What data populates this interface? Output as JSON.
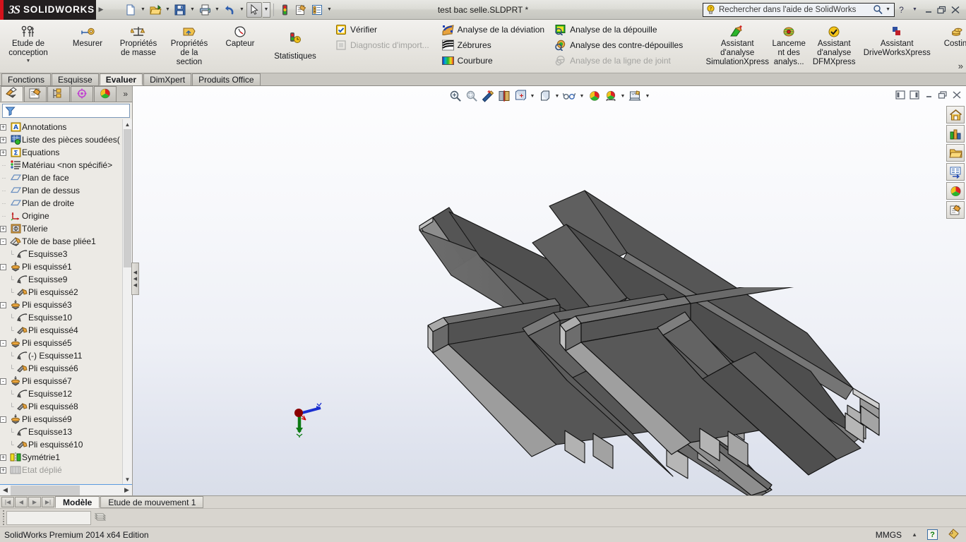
{
  "titlebar": {
    "brand_bs": "3S",
    "brand_name": "SOLIDWORKS",
    "document_title": "test bac selle.SLDPRT *",
    "quick_access": [
      {
        "name": "new-document",
        "icon": "new-doc-icon",
        "dropdown": true
      },
      {
        "name": "open-document",
        "icon": "open-folder-icon",
        "dropdown": true
      },
      {
        "name": "save-document",
        "icon": "save-disk-icon",
        "dropdown": true
      },
      {
        "name": "print-document",
        "icon": "printer-icon",
        "dropdown": true
      },
      {
        "name": "undo",
        "icon": "undo-arrow-icon",
        "dropdown": true
      },
      {
        "name": "select",
        "icon": "cursor-arrow-icon",
        "dropdown": true
      },
      {
        "name": "rebuild",
        "icon": "traffic-light-icon",
        "dropdown": false
      },
      {
        "name": "options",
        "icon": "options-gear-icon",
        "dropdown": false
      },
      {
        "name": "properties",
        "icon": "list-properties-icon",
        "dropdown": true
      }
    ],
    "search_placeholder": "Rechercher dans l'aide de SolidWorks",
    "window_buttons": [
      "help-icon",
      "help-dropdown",
      "minimize-icon",
      "restore-icon",
      "close-icon"
    ]
  },
  "ribbon": {
    "groups": [
      {
        "name": "design-study",
        "type": "big",
        "items": [
          {
            "label": "Etude de\nconception",
            "icon": "design-study-icon",
            "dropdown": true
          }
        ]
      },
      {
        "name": "evaluate-tools",
        "type": "big",
        "items": [
          {
            "label": "Mesurer",
            "icon": "measure-tape-icon",
            "dropdown": false
          },
          {
            "label": "Propriétés\nde masse",
            "icon": "mass-properties-icon",
            "dropdown": false
          },
          {
            "label": "Propriétés\nde la\nsection",
            "icon": "section-properties-icon",
            "dropdown": false
          },
          {
            "label": "Capteur",
            "icon": "sensor-gauge-icon",
            "dropdown": false
          },
          {
            "label": "Statistiques",
            "icon": "statistics-icon",
            "dropdown": false
          }
        ]
      },
      {
        "name": "check-group",
        "type": "small",
        "items": [
          {
            "label": "Vérifier",
            "icon": "check-yellow-icon",
            "disabled": false
          },
          {
            "label": "Diagnostic d'import...",
            "icon": "import-diagnostics-icon",
            "disabled": true
          }
        ]
      },
      {
        "name": "deviation-group",
        "type": "small",
        "items": [
          {
            "label": "Analyse de la déviation",
            "icon": "deviation-analysis-icon",
            "disabled": false
          },
          {
            "label": "Zébrures",
            "icon": "zebra-stripes-icon",
            "disabled": false
          },
          {
            "label": "Courbure",
            "icon": "curvature-rainbow-icon",
            "disabled": false
          }
        ]
      },
      {
        "name": "draft-group",
        "type": "small",
        "items": [
          {
            "label": "Analyse de la dépouille",
            "icon": "draft-analysis-icon",
            "disabled": false
          },
          {
            "label": "Analyse des contre-dépouilles",
            "icon": "undercut-analysis-icon",
            "disabled": false
          },
          {
            "label": "Analyse de la ligne de joint",
            "icon": "parting-line-analysis-icon",
            "disabled": true
          }
        ]
      },
      {
        "name": "xpress-group",
        "type": "big",
        "items": [
          {
            "label": "Assistant\nd'analyse\nSimulationXpress",
            "icon": "simulationxpress-icon",
            "dropdown": false
          },
          {
            "label": "Lanceme\nnt des\nanalys...",
            "icon": "run-analysis-icon",
            "dropdown": false
          },
          {
            "label": "Assistant\nd'analyse\nDFMXpress",
            "icon": "dfmxpress-check-icon",
            "dropdown": false
          },
          {
            "label": "Assistant\nDriveWorksXpress",
            "icon": "driveworksxpress-icon",
            "dropdown": false
          },
          {
            "label": "Costing",
            "icon": "costing-coins-icon",
            "dropdown": false
          }
        ]
      }
    ],
    "overflow_label": "»"
  },
  "command_tabs": [
    {
      "label": "Fonctions",
      "active": false
    },
    {
      "label": "Esquisse",
      "active": false
    },
    {
      "label": "Evaluer",
      "active": true
    },
    {
      "label": "DimXpert",
      "active": false
    },
    {
      "label": "Produits Office",
      "active": false
    }
  ],
  "feature_manager": {
    "tabs": [
      {
        "name": "feature-tree-tab",
        "icon": "feature-tree-icon",
        "active": true
      },
      {
        "name": "property-manager-tab",
        "icon": "property-manager-icon",
        "active": false
      },
      {
        "name": "configuration-manager-tab",
        "icon": "configuration-manager-icon",
        "active": false
      },
      {
        "name": "dimxpert-manager-tab",
        "icon": "dimxpert-manager-icon",
        "active": false
      },
      {
        "name": "display-manager-tab",
        "icon": "display-manager-icon",
        "active": false
      }
    ],
    "overflow_label": "»",
    "filter_icon": "filter-funnel-icon",
    "tree": [
      {
        "label": "Annotations",
        "icon": "annotations-icon",
        "indent": 0,
        "expand": "+",
        "disabled": false
      },
      {
        "label": "Liste des pièces soudées(",
        "icon": "weldment-cutlist-icon",
        "indent": 0,
        "expand": "+",
        "disabled": false
      },
      {
        "label": "Equations",
        "icon": "equations-icon",
        "indent": 0,
        "expand": "+",
        "disabled": false
      },
      {
        "label": "Matériau <non spécifié>",
        "icon": "material-icon",
        "indent": 0,
        "expand": "",
        "disabled": false
      },
      {
        "label": "Plan de face",
        "icon": "plane-icon",
        "indent": 0,
        "expand": "",
        "disabled": false
      },
      {
        "label": "Plan de dessus",
        "icon": "plane-icon",
        "indent": 0,
        "expand": "",
        "disabled": false
      },
      {
        "label": "Plan de droite",
        "icon": "plane-icon",
        "indent": 0,
        "expand": "",
        "disabled": false
      },
      {
        "label": "Origine",
        "icon": "origin-icon",
        "indent": 0,
        "expand": "",
        "disabled": false
      },
      {
        "label": "Tôlerie",
        "icon": "sheetmetal-icon",
        "indent": 0,
        "expand": "+",
        "disabled": false
      },
      {
        "label": "Tôle de base pliée1",
        "icon": "base-flange-icon",
        "indent": 0,
        "expand": "-",
        "disabled": false
      },
      {
        "label": "Esquisse3",
        "icon": "sketch-icon",
        "indent": 1,
        "expand": "",
        "disabled": false
      },
      {
        "label": "Pli esquissé1",
        "icon": "sketched-bend-icon",
        "indent": 0,
        "expand": "-",
        "disabled": false
      },
      {
        "label": "Esquisse9",
        "icon": "sketch-icon",
        "indent": 1,
        "expand": "",
        "disabled": false
      },
      {
        "label": "Pli esquissé2",
        "icon": "bend-icon",
        "indent": 1,
        "expand": "",
        "disabled": false
      },
      {
        "label": "Pli esquissé3",
        "icon": "sketched-bend-icon",
        "indent": 0,
        "expand": "-",
        "disabled": false
      },
      {
        "label": "Esquisse10",
        "icon": "sketch-icon",
        "indent": 1,
        "expand": "",
        "disabled": false
      },
      {
        "label": "Pli esquissé4",
        "icon": "bend-icon",
        "indent": 1,
        "expand": "",
        "disabled": false
      },
      {
        "label": "Pli esquissé5",
        "icon": "sketched-bend-icon",
        "indent": 0,
        "expand": "-",
        "disabled": false
      },
      {
        "label": "(-) Esquisse11",
        "icon": "sketch-icon",
        "indent": 1,
        "expand": "",
        "disabled": false
      },
      {
        "label": "Pli esquissé6",
        "icon": "bend-icon",
        "indent": 1,
        "expand": "",
        "disabled": false
      },
      {
        "label": "Pli esquissé7",
        "icon": "sketched-bend-icon",
        "indent": 0,
        "expand": "-",
        "disabled": false
      },
      {
        "label": "Esquisse12",
        "icon": "sketch-icon",
        "indent": 1,
        "expand": "",
        "disabled": false
      },
      {
        "label": "Pli esquissé8",
        "icon": "bend-icon",
        "indent": 1,
        "expand": "",
        "disabled": false
      },
      {
        "label": "Pli esquissé9",
        "icon": "sketched-bend-icon",
        "indent": 0,
        "expand": "-",
        "disabled": false
      },
      {
        "label": "Esquisse13",
        "icon": "sketch-icon",
        "indent": 1,
        "expand": "",
        "disabled": false
      },
      {
        "label": "Pli esquissé10",
        "icon": "bend-icon",
        "indent": 1,
        "expand": "",
        "disabled": false
      },
      {
        "label": "Symétrie1",
        "icon": "mirror-icon",
        "indent": 0,
        "expand": "+",
        "disabled": false
      },
      {
        "label": "Etat déplié",
        "icon": "flat-pattern-icon",
        "indent": 0,
        "expand": "+",
        "disabled": true
      }
    ]
  },
  "view_toolbar": [
    {
      "name": "zoom-to-fit-button",
      "icon": "zoom-to-fit-icon",
      "dropdown": false
    },
    {
      "name": "zoom-to-area-button",
      "icon": "zoom-to-area-icon",
      "dropdown": false
    },
    {
      "name": "previous-view-button",
      "icon": "previous-view-icon",
      "dropdown": false
    },
    {
      "name": "section-view-button",
      "icon": "section-view-icon",
      "dropdown": false
    },
    {
      "name": "view-orientation-button",
      "icon": "view-orientation-icon",
      "dropdown": true
    },
    {
      "name": "display-style-button",
      "icon": "display-style-icon",
      "dropdown": true
    },
    {
      "name": "hide-show-items-button",
      "icon": "glasses-icon",
      "dropdown": true
    },
    {
      "name": "edit-appearance-button",
      "icon": "appearance-sphere-icon",
      "dropdown": false
    },
    {
      "name": "apply-scene-button",
      "icon": "scene-icon",
      "dropdown": true
    },
    {
      "name": "view-settings-button",
      "icon": "view-settings-icon",
      "dropdown": true
    }
  ],
  "window_controls": [
    {
      "name": "tile-left-button",
      "icon": "tile-left-icon"
    },
    {
      "name": "tile-right-button",
      "icon": "tile-right-icon"
    },
    {
      "name": "minimize-document-button",
      "icon": "minimize-icon"
    },
    {
      "name": "restore-document-button",
      "icon": "restore-icon"
    },
    {
      "name": "close-document-button",
      "icon": "close-icon"
    }
  ],
  "right_toolbar": [
    {
      "name": "resources-home-button",
      "icon": "home-house-icon"
    },
    {
      "name": "design-library-button",
      "icon": "design-library-icon"
    },
    {
      "name": "file-explorer-button",
      "icon": "file-explorer-folder-icon"
    },
    {
      "name": "search-panel-button",
      "icon": "search-panel-icon"
    },
    {
      "name": "appearances-scenes-button",
      "icon": "appearances-sphere-icon"
    },
    {
      "name": "custom-properties-button",
      "icon": "custom-properties-icon"
    }
  ],
  "triad": {
    "x_label": "",
    "y_label": "Y",
    "z_label": "Z",
    "x_color": "#d00000",
    "y_color": "#0d7a14",
    "z_color": "#1a2fd0"
  },
  "model_tabs": {
    "nav_buttons": [
      "first-tab-icon",
      "previous-tab-icon",
      "next-tab-icon",
      "last-tab-icon"
    ],
    "tabs": [
      {
        "label": "Modèle",
        "active": true
      },
      {
        "label": "Etude de mouvement 1",
        "active": false
      }
    ]
  },
  "config_bar": {
    "selected_configuration": "",
    "copy_icon": "copy-stack-icon"
  },
  "statusbar": {
    "message": "SolidWorks Premium 2014 x64 Edition",
    "units": "MMGS",
    "units_arrow": "▲",
    "help_icon": "green-question-icon",
    "tag_icon": "tag-icon"
  },
  "colors": {
    "brand_red": "#d4131c",
    "brand_black": "#231f20",
    "ribbon_bg": "#e6e4df",
    "panel_bg": "#eceae5",
    "graphics_top": "#fdfdfe",
    "graphics_bottom": "#d9dee9",
    "model_dark": "#4a4a4a",
    "model_mid": "#6e6e6e",
    "model_light": "#9a9a9a"
  },
  "model": {
    "name": "bac-selle-sheet-metal-part",
    "description": "Tôle pliée profilée – bac de selle"
  }
}
